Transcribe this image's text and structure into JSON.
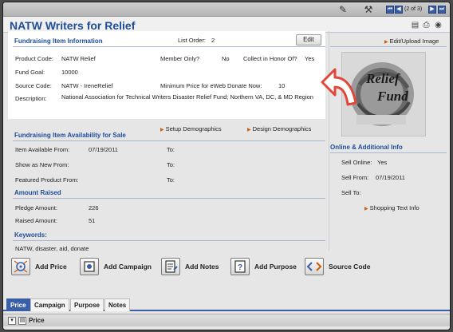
{
  "topbar": {
    "page_count": "(2 of 3)",
    "nav": {
      "first": "⏮",
      "prev": "◀",
      "next": "▶",
      "last": "⏭"
    },
    "icons": [
      "pencil-icon",
      "wrench-icon"
    ]
  },
  "title": "NATW Writers for Relief",
  "info": {
    "heading": "Fundraising Item Information",
    "list_order_label": "List Order:",
    "list_order_value": "2",
    "edit_label": "Edit",
    "product_code_label": "Product Code:",
    "product_code_value": "NATW Relief",
    "member_only_label": "Member Only?",
    "member_only_value": "No",
    "collect_label": "Collect in Honor Of?",
    "collect_value": "Yes",
    "fund_goal_label": "Fund Goal:",
    "fund_goal_value": "10000",
    "source_code_label": "Source Code:",
    "source_code_value": "NATW - IreneRelief",
    "min_price_label": "Minimum Price for eWeb Donate Now:",
    "min_price_value": "10",
    "description_label": "Description:",
    "description_value": "National Association for Technical Writers Disaster Relief Fund; Northern VA, DC, & MD Region"
  },
  "right": {
    "upload_link": "Edit/Upload Image",
    "logo_text_line1": "Relief",
    "logo_text_line2": "Fund",
    "online_heading": "Online & Additional Info",
    "sell_online_label": "Sell Online:",
    "sell_online_value": "Yes",
    "sell_from_label": "Sell From:",
    "sell_from_value": "07/19/2011",
    "sell_to_label": "Sell To:",
    "shopping_link": "Shopping Text Info"
  },
  "availability": {
    "heading": "Fundraising Item Availability for Sale",
    "setup_link": "Setup Demographics",
    "design_link": "Design Demographics",
    "item_available_label": "Item Available From:",
    "item_available_value": "07/19/2011",
    "show_new_label": "Show as New From:",
    "featured_label": "Featured Product From:",
    "to_label": "To:"
  },
  "amount": {
    "heading": "Amount Raised",
    "pledge_label": "Pledge Amount:",
    "pledge_value": "226",
    "raised_label": "Raised Amount:",
    "raised_value": "51"
  },
  "keywords": {
    "heading": "Keywords:",
    "value": "NATW, disaster, aid, donate"
  },
  "actions": [
    {
      "label": "Add Price"
    },
    {
      "label": "Add Campaign"
    },
    {
      "label": "Add Notes"
    },
    {
      "label": "Add Purpose"
    },
    {
      "label": "Source Code"
    }
  ],
  "tabs": [
    "Price",
    "Campaign",
    "Purpose",
    "Notes"
  ],
  "bottom": {
    "label": "Price"
  },
  "colors": {
    "accent": "#1f4d9a",
    "arrow": "#d45a00",
    "callout": "#e0473a"
  }
}
